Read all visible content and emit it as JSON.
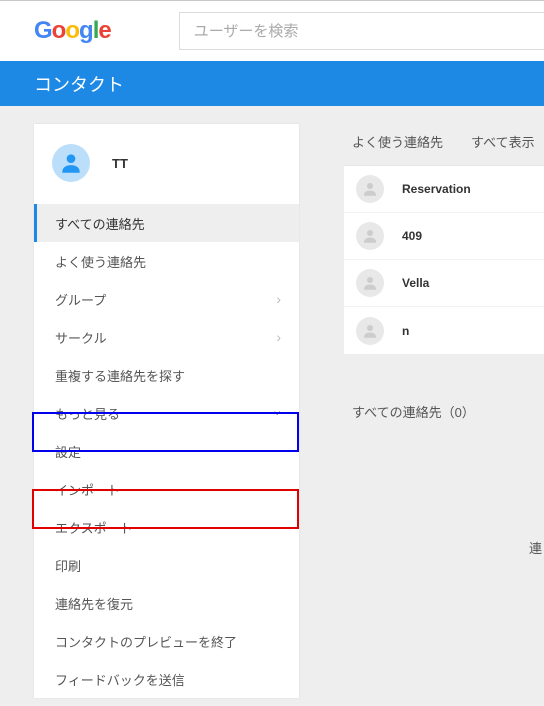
{
  "search": {
    "placeholder": "ユーザーを検索"
  },
  "appbar": {
    "title": "コンタクト"
  },
  "profile": {
    "name": "TT"
  },
  "nav": {
    "all_contacts": "すべての連絡先",
    "frequent": "よく使う連絡先",
    "groups": "グループ",
    "circles": "サークル",
    "duplicates": "重複する連絡先を探す",
    "more": "もっと見る",
    "settings": "設定",
    "import": "インポート",
    "export": "エクスポート",
    "print": "印刷",
    "restore": "連絡先を復元",
    "exit_preview": "コンタクトのプレビューを終了",
    "feedback": "フィードバックを送信"
  },
  "right": {
    "frequent_header": "よく使う連絡先",
    "show_all": "すべて表示",
    "all_contacts_label": "すべての連絡先（0）",
    "side_char": "連"
  },
  "contacts": [
    {
      "name": "Reservation"
    },
    {
      "name": "409"
    },
    {
      "name": "Vella"
    },
    {
      "name": "n"
    }
  ]
}
